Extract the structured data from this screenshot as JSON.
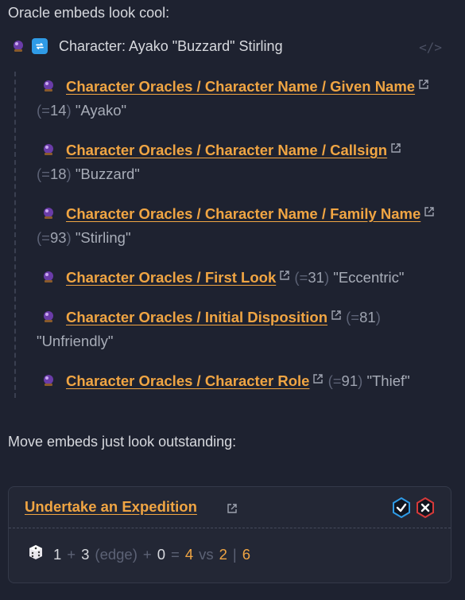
{
  "intro": "Oracle embeds look cool:",
  "character": {
    "title": "Character: Ayako \"Buzzard\" Stirling",
    "icons": [
      "crystal-ball-icon",
      "repeat-icon",
      "code-icon"
    ]
  },
  "oracles": [
    {
      "path": "Character Oracles / Character Name / Given Name",
      "roll": "14",
      "result": "\"Ayako\""
    },
    {
      "path": "Character Oracles / Character Name / Callsign",
      "roll": "18",
      "result": "\"Buzzard\""
    },
    {
      "path": "Character Oracles / Character Name / Family Name",
      "roll": "93",
      "result": "\"Stirling\""
    },
    {
      "path": "Character Oracles / First Look",
      "roll": "31",
      "result": "\"Eccentric\""
    },
    {
      "path": "Character Oracles / Initial Disposition",
      "roll": "81",
      "result": "\"Unfriendly\""
    },
    {
      "path": "Character Oracles / Character Role",
      "roll": "91",
      "result": "\"Thief\""
    }
  ],
  "roll_prefix": "(=",
  "roll_suffix": ")",
  "move_intro": "Move embeds just look outstanding:",
  "move": {
    "title": "Undertake an Expedition",
    "action_die": "1",
    "stat": "3",
    "stat_label": "(edge)",
    "adds": "0",
    "total": "4",
    "vs": "vs",
    "challenge1": "2",
    "sep": "|",
    "challenge2": "6",
    "plus": "+",
    "equals": "=",
    "colors": {
      "accent": "#f0a543",
      "badge_blue": "#2f9be6",
      "badge_red": "#d63a3a"
    }
  }
}
